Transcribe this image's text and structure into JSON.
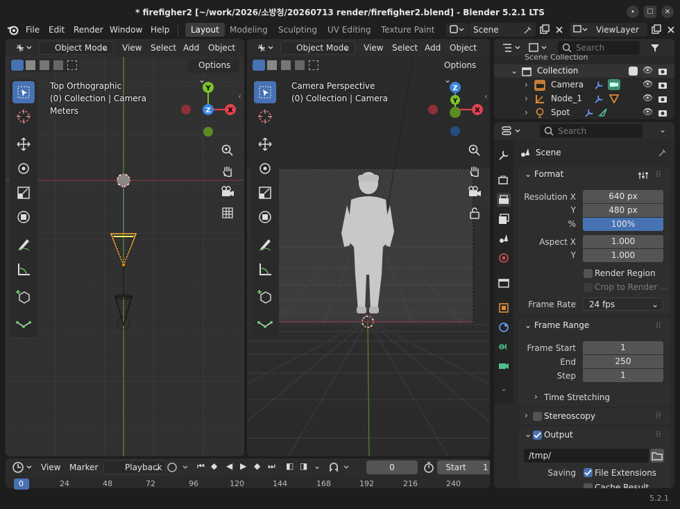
{
  "window": {
    "title": "* firefigher2 [~/work/2026/소방청/20260713 render/firefigher2.blend] - Blender 5.2.1 LTS"
  },
  "menubar": {
    "items": [
      "File",
      "Edit",
      "Render",
      "Window",
      "Help"
    ],
    "workspaces": [
      "Layout",
      "Modeling",
      "Sculpting",
      "UV Editing",
      "Texture Paint"
    ],
    "scene": "Scene",
    "view_layer": "ViewLayer"
  },
  "viewport_left": {
    "mode": "Object Mode",
    "menus": [
      "View",
      "Select",
      "Add",
      "Object"
    ],
    "options": "Options",
    "info": [
      "Top Orthographic",
      "(0) Collection | Camera",
      "Meters"
    ],
    "gizmo": {
      "y": "Y",
      "z": "Z",
      "x": "X"
    }
  },
  "viewport_right": {
    "mode": "Object Mode",
    "menus": [
      "View",
      "Select",
      "Add",
      "Object"
    ],
    "options": "Options",
    "info": [
      "Camera Perspective",
      "(0) Collection | Camera"
    ],
    "gizmo": {
      "y": "Y",
      "z": "Z",
      "x": "X"
    }
  },
  "outliner": {
    "search_placeholder": "Search",
    "root": "Scene Collection",
    "collection": "Collection",
    "items": [
      "Camera",
      "Node_1",
      "Spot"
    ]
  },
  "properties": {
    "search_placeholder": "Search",
    "context": "Scene",
    "format": {
      "title": "Format",
      "res_x_label": "Resolution X",
      "res_x": "640 px",
      "res_y_label": "Y",
      "res_y": "480 px",
      "pct_label": "%",
      "pct": "100%",
      "aspect_x_label": "Aspect X",
      "aspect_x": "1.000",
      "aspect_y_label": "Y",
      "aspect_y": "1.000",
      "render_region": "Render Region",
      "crop": "Crop to Render ...",
      "frame_rate_label": "Frame Rate",
      "frame_rate": "24 fps"
    },
    "frame_range": {
      "title": "Frame Range",
      "start_label": "Frame Start",
      "start": "1",
      "end_label": "End",
      "end": "250",
      "step_label": "Step",
      "step": "1",
      "time_stretching": "Time Stretching"
    },
    "stereoscopy": "Stereoscopy",
    "output": {
      "title": "Output",
      "path": "/tmp/",
      "saving_label": "Saving",
      "file_ext": "File Extensions",
      "cache": "Cache Result"
    }
  },
  "timeline": {
    "menus": [
      "View",
      "Marker"
    ],
    "playback": "Playback",
    "frame": "0",
    "start_label": "Start",
    "start_val": "1",
    "ruler": [
      "0",
      "24",
      "48",
      "72",
      "96",
      "120",
      "144",
      "168",
      "192",
      "216",
      "240"
    ]
  },
  "status": {
    "version": "5.2.1"
  },
  "colors": {
    "accent": "#4772b3",
    "x_axis": "#e0424f",
    "y_axis": "#7cc22b",
    "z_axis": "#3a85e0"
  }
}
